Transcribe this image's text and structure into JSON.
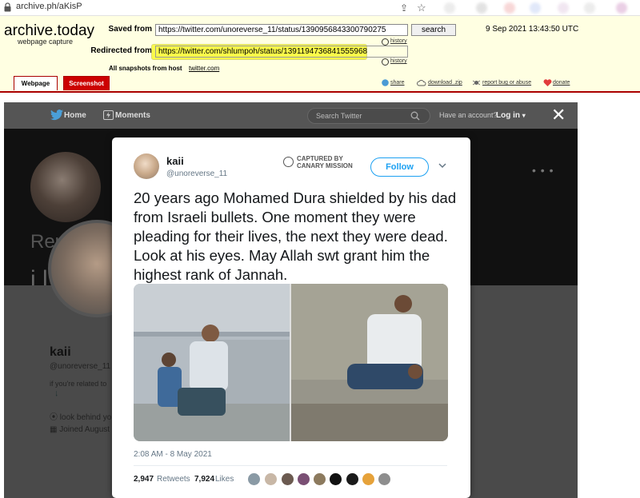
{
  "browser": {
    "url": "archive.ph/aKisP"
  },
  "archive": {
    "title": "archive.today",
    "subtitle": "webpage capture",
    "saved_from_label": "Saved from",
    "saved_from_url": "https://twitter.com/unoreverse_11/status/1390956843300790275",
    "search_label": "search",
    "date": "9 Sep 2021 13:43:50 UTC",
    "history_label": "history",
    "redirected_from_label": "Redirected from",
    "redirected_from_url": "https://twitter.com/shlumpoh/status/1391194736841555968",
    "all_snapshots_label": "All snapshots  from host",
    "snapshots_host": "twitter.com",
    "tabs": [
      "Webpage",
      "Screenshot"
    ],
    "actions": [
      "share",
      "download .zip",
      "report bug or abuse",
      "donate"
    ]
  },
  "twitter_nav": {
    "home": "Home",
    "moments": "Moments",
    "search_placeholder": "Search Twitter",
    "have_account": "Have an account?",
    "login": "Log in"
  },
  "background_profile": {
    "replying": "Replying",
    "fragment": "i l",
    "name": "kaii",
    "handle": "@unoreverse_11",
    "bio": "if you're related to",
    "location": "look behind yo",
    "joined": "Joined August"
  },
  "tweet": {
    "name": "kaii",
    "handle": "@unoreverse_11",
    "captured_by": [
      "CAPTURED BY",
      "CANARY MISSION"
    ],
    "follow_label": "Follow",
    "text": "20 years ago Mohamed Dura shielded by his dad from Israeli bullets. One moment they were pleading for their lives, the next they were dead. Look at his eyes. May Allah swt grant him the highest rank of Jannah.",
    "time": "2:08 AM - 8 May 2021",
    "retweets_count": "2,947",
    "retweets_label": "Retweets",
    "likes_count": "7,924",
    "likes_label": "Likes"
  },
  "colors": {
    "twitter_blue": "#1da1f2",
    "archive_bg": "#ffffe2",
    "archive_red": "#aa0000",
    "highlight": "#fbfb3a"
  }
}
